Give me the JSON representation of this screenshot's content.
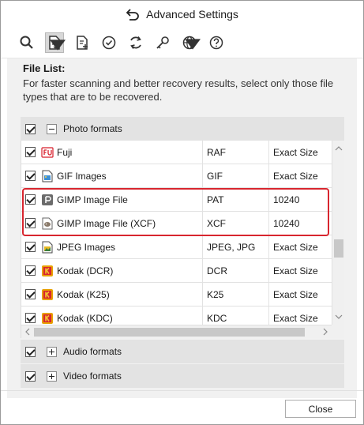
{
  "window": {
    "title": "Advanced Settings"
  },
  "toolbar": {
    "buttons": [
      {
        "icon": "search-icon"
      },
      {
        "icon": "file-list-icon",
        "active": true
      },
      {
        "icon": "add-file-icon"
      },
      {
        "icon": "check-icon"
      },
      {
        "icon": "refresh-icon"
      },
      {
        "icon": "key-icon"
      },
      {
        "icon": "globe-icon"
      },
      {
        "icon": "help-icon"
      }
    ]
  },
  "file_list": {
    "label": "File List:",
    "description": "For faster scanning and better recovery results, select only those file types that are to be recovered."
  },
  "groups": {
    "photo": {
      "label": "Photo formats",
      "checked": true,
      "expanded": true
    },
    "audio": {
      "label": "Audio formats",
      "checked": true,
      "expanded": false
    },
    "video": {
      "label": "Video formats",
      "checked": true,
      "expanded": false
    }
  },
  "rows": [
    {
      "name": "Fuji",
      "ext": "RAF",
      "size": "Exact Size",
      "icon": "fuji-icon",
      "checked": true
    },
    {
      "name": "GIF Images",
      "ext": "GIF",
      "size": "Exact Size",
      "icon": "gif-icon",
      "checked": true
    },
    {
      "name": "GIMP Image File",
      "ext": "PAT",
      "size": "10240",
      "icon": "gimp-pattern-icon",
      "checked": true
    },
    {
      "name": "GIMP Image File (XCF)",
      "ext": "XCF",
      "size": "10240",
      "icon": "gimp-xcf-icon",
      "checked": true
    },
    {
      "name": "JPEG Images",
      "ext": "JPEG, JPG",
      "size": "Exact Size",
      "icon": "jpeg-icon",
      "checked": true
    },
    {
      "name": "Kodak (DCR)",
      "ext": "DCR",
      "size": "Exact Size",
      "icon": "kodak-icon",
      "checked": true
    },
    {
      "name": "Kodak (K25)",
      "ext": "K25",
      "size": "Exact Size",
      "icon": "kodak-icon",
      "checked": true
    },
    {
      "name": "Kodak (KDC)",
      "ext": "KDC",
      "size": "Exact Size",
      "icon": "kodak-icon",
      "checked": true
    }
  ],
  "scroll": {
    "vertical_position": 0.62,
    "vertical_visible": 0.12,
    "horizontal_position": 0.0,
    "horizontal_visible": 0.95
  },
  "colors": {
    "highlight": "#d8262f",
    "kodak": "#e8a000",
    "fuji": "#d81e2b"
  },
  "footer": {
    "close_label": "Close"
  }
}
